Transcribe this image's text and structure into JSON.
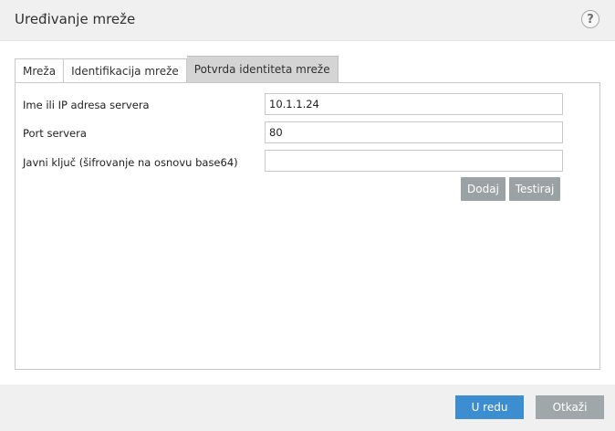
{
  "window": {
    "title": "Uređivanje mreže",
    "help_label": "?"
  },
  "tabs": [
    {
      "label": "Mreža",
      "active": false
    },
    {
      "label": "Identifikacija mreže",
      "active": false
    },
    {
      "label": "Potvrda identiteta mreže",
      "active": true
    }
  ],
  "form": {
    "server_label": "Ime ili IP adresa servera",
    "server_value": "10.1.1.24",
    "port_label": "Port servera",
    "port_value": "80",
    "key_label": "Javni ključ (šifrovanje na osnovu base64)",
    "key_value": "",
    "add_label": "Dodaj",
    "test_label": "Testiraj"
  },
  "footer": {
    "ok_label": "U redu",
    "cancel_label": "Otkaži"
  },
  "colors": {
    "primary_button": "#3d8dd1",
    "secondary_button": "#a0a7ab",
    "active_tab": "#d4d4d4"
  }
}
